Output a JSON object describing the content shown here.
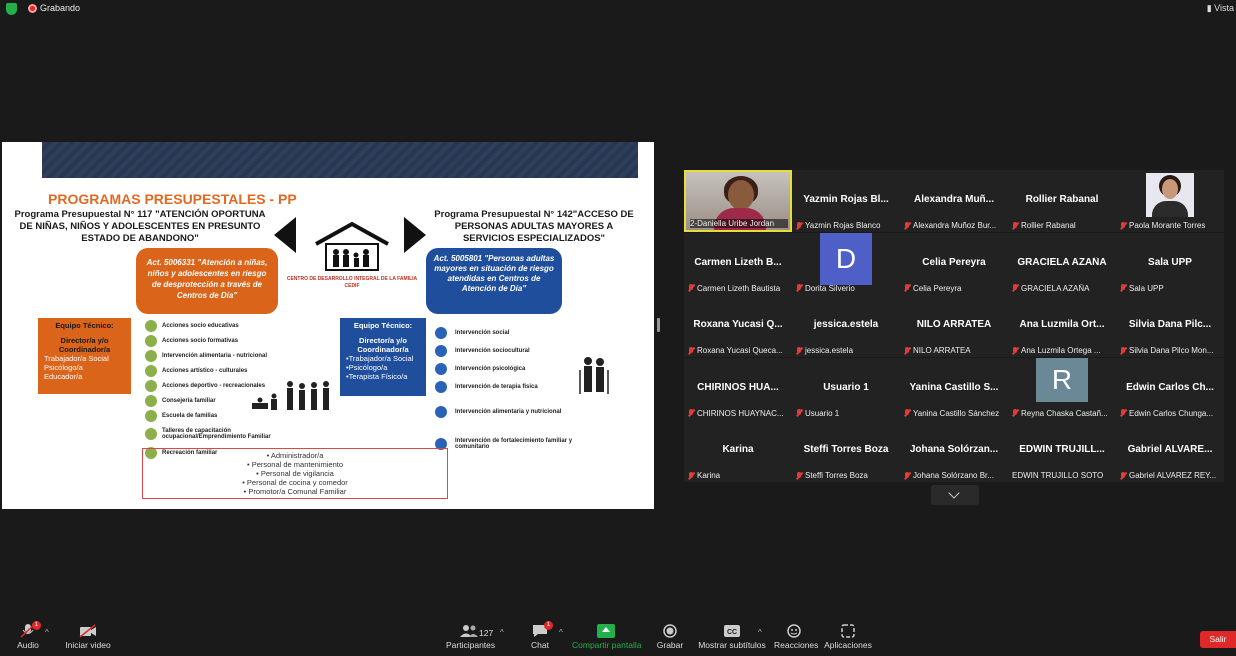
{
  "topbar": {
    "recording_label": "Grabando",
    "view_label": "Vista"
  },
  "slide": {
    "title": "PROGRAMAS PRESUPESTALES - PP",
    "program_117": "Programa Presupuestal N° 117 \"ATENCIÓN OPORTUNA DE NIÑAS, NIÑOS Y ADOLESCENTES EN PRESUNTO ESTADO DE ABANDONO\"",
    "program_142": "Programa Presupuestal N° 142\"ACCESO DE PERSONAS ADULTAS MAYORES A SERVICIOS ESPECIALIZADOS\"",
    "cedif_caption": "CENTRO DE DESARROLLO INTEGRAL DE LA FAMILIA CEDIF",
    "act_left": "Act. 5006331 \"Atención a niñas, niños y adolescentes en riesgo de desprotección a través de Centros de Día\"",
    "act_right": "Act. 5005801 \"Personas adultas mayores en situación de riesgo atendidas en Centros de Atención de Día\"",
    "team_left": {
      "title": "Equipo Técnico:",
      "sub": "Director/a y/o Coordinador/a",
      "items": [
        "Trabajador/a Social",
        "Psicólogo/a",
        "Educador/a"
      ]
    },
    "team_right": {
      "title": "Equipo Técnico:",
      "sub": "Director/a y/o Coordinador/a",
      "items": [
        "•Trabajador/a Social",
        "•Psicólogo/a",
        "•Terapista Físico/a"
      ]
    },
    "actions_left": [
      "Acciones socio educativas",
      "Acciones socio formativas",
      "Intervención alimentaria - nutricional",
      "Acciones artístico - culturales",
      "Acciones deportivo - recreacionales",
      "Consejería familiar",
      "Escuela de familias",
      "Talleres de capacitación ocupacional/Emprendimiento Familiar",
      "Recreación familiar"
    ],
    "actions_right": [
      "Intervención social",
      "Intervención sociocultural",
      "Intervención psicológica",
      "Intervención de terapia física",
      "Intervención alimentaria y nutricional",
      "Intervención de fortalecimiento familiar y comunitario"
    ],
    "staff": [
      "• Administrador/a",
      "• Personal de mantenimiento",
      "• Personal de vigilancia",
      "• Personal de cocina y comedor",
      "• Promotor/a Comunal Familiar"
    ]
  },
  "participants": [
    {
      "name": "",
      "label": "2-Daniella Uribe Jordan",
      "type": "video",
      "muted": false,
      "active": true
    },
    {
      "name": "Yazmin Rojas Bl...",
      "label": "Yazmin Rojas Blanco",
      "type": "name",
      "muted": true
    },
    {
      "name": "Alexandra Muñ...",
      "label": "Alexandra Muñoz Bur...",
      "type": "name",
      "muted": true
    },
    {
      "name": "Rollier Rabanal",
      "label": "Rollier Rabanal",
      "type": "name",
      "muted": true
    },
    {
      "name": "",
      "label": "Paola Morante Torres",
      "type": "photo",
      "muted": true
    },
    {
      "name": "Carmen Lizeth B...",
      "label": "Carmen Lizeth Bautista",
      "type": "name",
      "muted": true
    },
    {
      "name": "D",
      "label": "Dorita Silverio",
      "type": "avatarD",
      "muted": true
    },
    {
      "name": "Celia Pereyra",
      "label": "Celia Pereyra",
      "type": "name",
      "muted": true
    },
    {
      "name": "GRACIELA AZAÑA",
      "label": "GRACIELA AZAÑA",
      "type": "name",
      "muted": true
    },
    {
      "name": "Sala UPP",
      "label": "Sala UPP",
      "type": "name",
      "muted": true
    },
    {
      "name": "Roxana Yucasi Q...",
      "label": "Roxana Yucasi Queca...",
      "type": "name",
      "muted": true
    },
    {
      "name": "jessica.estela",
      "label": "jessica.estela",
      "type": "name",
      "muted": true
    },
    {
      "name": "NILO ARRATEA",
      "label": "NILO ARRATEA",
      "type": "name",
      "muted": true
    },
    {
      "name": "Ana Luzmila Ort...",
      "label": "Ana Luzmila Ortega ...",
      "type": "name",
      "muted": true
    },
    {
      "name": "Silvia Dana Pilc...",
      "label": "Silvia Dana Pilco Mon...",
      "type": "name",
      "muted": true
    },
    {
      "name": "CHIRINOS HUA...",
      "label": "CHIRINOS HUAYNAC...",
      "type": "name",
      "muted": true
    },
    {
      "name": "Usuario 1",
      "label": "Usuario 1",
      "type": "name",
      "muted": true
    },
    {
      "name": "Yanina Castillo S...",
      "label": "Yanina Castillo Sánchez",
      "type": "name",
      "muted": true
    },
    {
      "name": "R",
      "label": "Reyna Chaska Castañ...",
      "type": "avatarR",
      "muted": true
    },
    {
      "name": "Edwin Carlos Ch...",
      "label": "Edwin Carlos Chunga...",
      "type": "name",
      "muted": true
    },
    {
      "name": "Karina",
      "label": "Karina",
      "type": "name",
      "muted": true
    },
    {
      "name": "Steffi Torres Boza",
      "label": "Steffi Torres Boza",
      "type": "name",
      "muted": true
    },
    {
      "name": "Johana Solórzan...",
      "label": "Johana Solórzano Br...",
      "type": "name",
      "muted": true
    },
    {
      "name": "EDWIN TRUJILL...",
      "label": "EDWIN TRUJILLO SOTO",
      "type": "name",
      "muted": false
    },
    {
      "name": "Gabriel ALVARE...",
      "label": "Gabriel ALVAREZ REY...",
      "type": "name",
      "muted": true
    }
  ],
  "toolbar": {
    "audio": "Audio",
    "video": "Iniciar video",
    "participants": "Participantes",
    "participants_count": "127",
    "chat": "Chat",
    "chat_badge": "1",
    "audio_badge": "1",
    "share": "Compartir pantalla",
    "record": "Grabar",
    "subtitles": "Mostrar subtítulos",
    "reactions": "Reacciones",
    "apps": "Aplicaciones",
    "leave": "Salir"
  },
  "colors": {
    "share_green": "#23b04a",
    "leave_red": "#e02828",
    "active_speaker": "#e6dc3b",
    "slide_orange": "#d9641a",
    "slide_blue": "#1f4e9c"
  }
}
